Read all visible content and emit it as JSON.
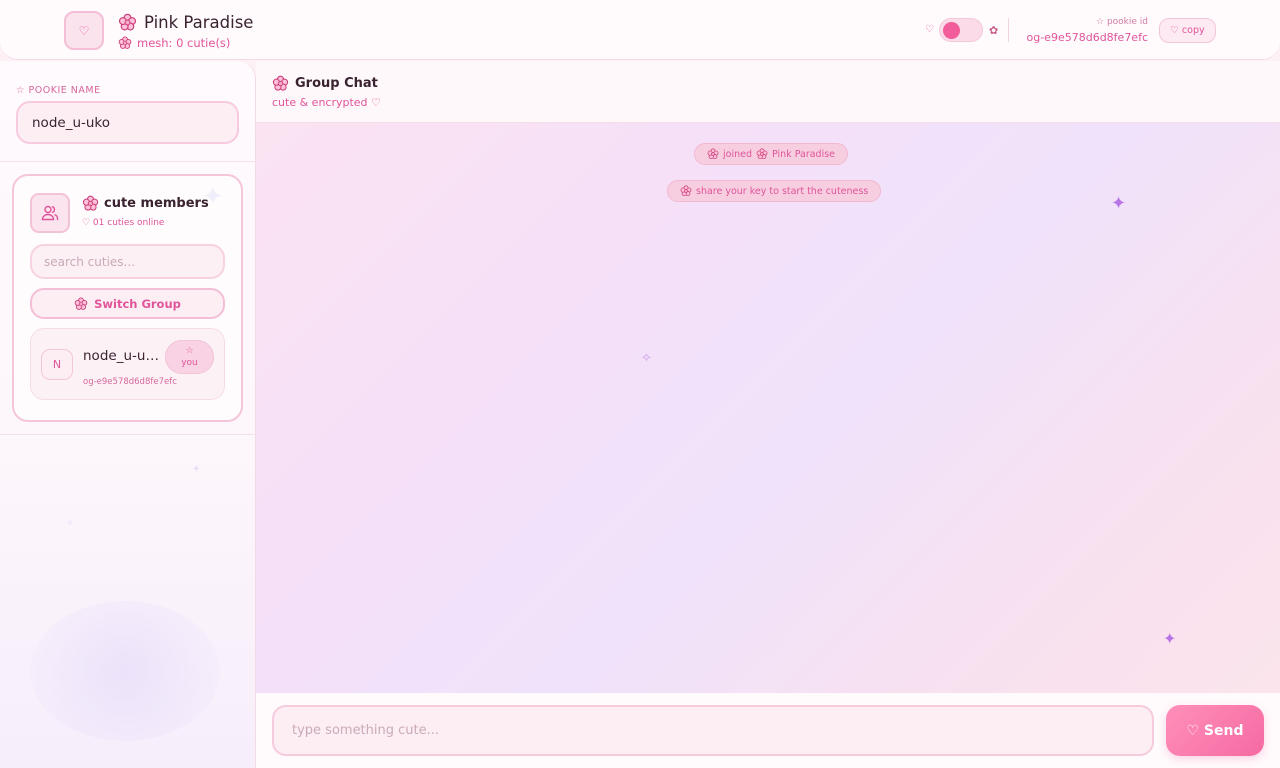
{
  "colors": {
    "accent": "#e0559a",
    "accent_strong": "#f25c9b",
    "card_border": "#f5c6da",
    "panel_bg": "#fffafc",
    "sparkle": "#b774e6"
  },
  "header": {
    "logo_glyph": "♡",
    "app_name": "Pink Paradise",
    "mesh_status": "mesh: 0 cutie(s)",
    "theme_heart_glyph": "♡",
    "theme_gear_glyph": "✿",
    "pookie_id_label": "☆ pookie id",
    "pookie_id_value": "og-e9e578d6d8fe7efc",
    "copy_label": "♡ copy"
  },
  "sidebar": {
    "name_label": "☆ POOKIE NAME",
    "name_value": "node_u-uko",
    "members": {
      "title": "cute members",
      "online_count": "♡ 01 cuties online",
      "search_placeholder": "search cuties...",
      "switch_group_label": "Switch Group",
      "list": [
        {
          "avatar_letter": "N",
          "name": "node_u-uko",
          "badge_top": "☆",
          "badge_bottom": "you",
          "id": "og-e9e578d6d8fe7efc"
        }
      ]
    }
  },
  "chat": {
    "title": "Group Chat",
    "subtitle": "cute & encrypted ♡",
    "system_messages": [
      {
        "prefix": "joined",
        "group": "Pink Paradise"
      },
      {
        "text": "share your key to start the cuteness"
      }
    ]
  },
  "composer": {
    "placeholder": "type something cute...",
    "send_label": "♡ Send"
  },
  "icons": {
    "logo": "heart-icon",
    "flower": "flower-icon",
    "members": "users-icon",
    "sparkle": "sparkle-icon"
  }
}
